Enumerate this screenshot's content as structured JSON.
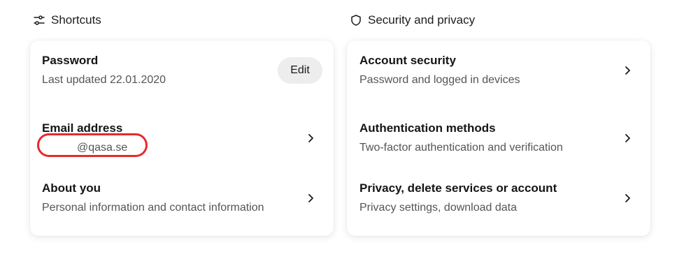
{
  "shortcuts": {
    "header": "Shortcuts",
    "icon": "sliders-icon",
    "password": {
      "title": "Password",
      "subtitle": "Last updated 22.01.2020",
      "edit_label": "Edit"
    },
    "email": {
      "title": "Email address",
      "value": "@qasa.se"
    },
    "about": {
      "title": "About you",
      "subtitle": "Personal information and contact information"
    }
  },
  "security": {
    "header": "Security and privacy",
    "icon": "shield-icon",
    "items": [
      {
        "title": "Account security",
        "subtitle": "Password and logged in devices"
      },
      {
        "title": "Authentication methods",
        "subtitle": "Two-factor authentication and verification"
      },
      {
        "title": "Privacy, delete services or account",
        "subtitle": "Privacy settings, download data"
      }
    ]
  },
  "colors": {
    "annotation_red": "#e52b2b",
    "edit_button_bg": "#ededed",
    "subtitle_text": "#555555"
  }
}
